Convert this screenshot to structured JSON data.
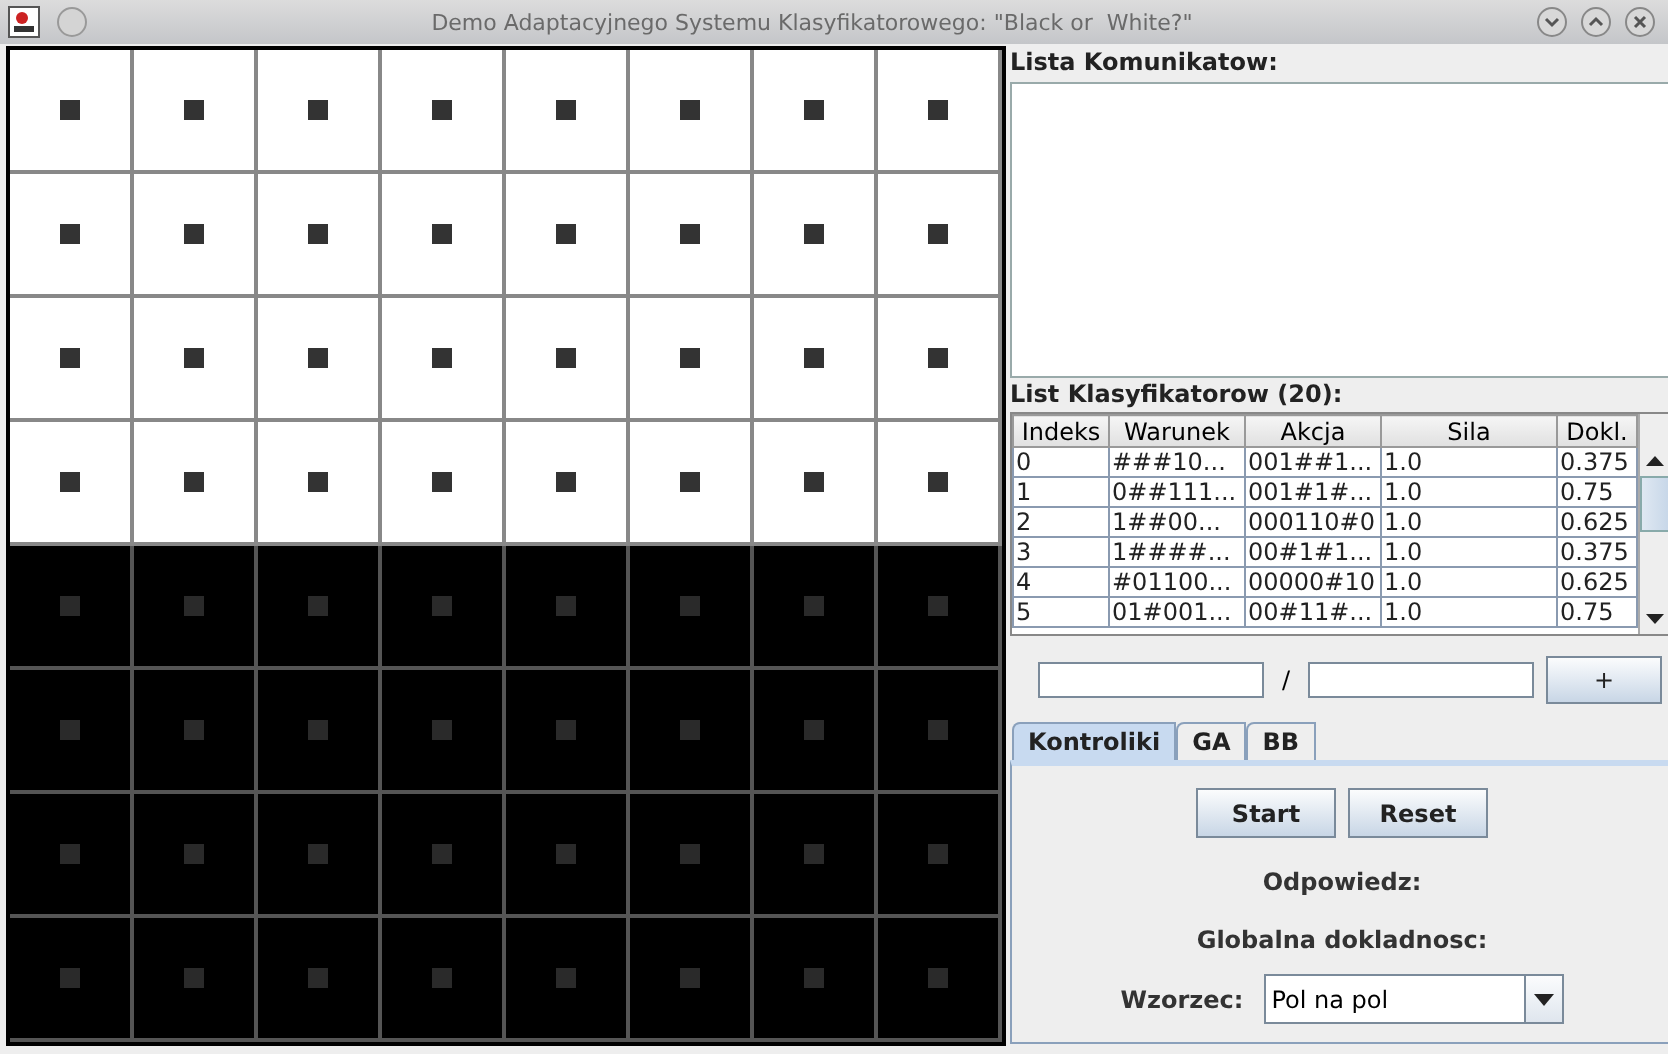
{
  "window": {
    "title": "Demo Adaptacyjnego Systemu Klasyfikatorowego: \"Black or  White?\""
  },
  "board": {
    "rows": [
      {
        "cells": [
          {
            "dark": false
          },
          {
            "dark": false
          },
          {
            "dark": false
          },
          {
            "dark": false
          },
          {
            "dark": false
          },
          {
            "dark": false
          },
          {
            "dark": false
          },
          {
            "dark": false
          }
        ]
      },
      {
        "cells": [
          {
            "dark": false
          },
          {
            "dark": false
          },
          {
            "dark": false
          },
          {
            "dark": false
          },
          {
            "dark": false
          },
          {
            "dark": false
          },
          {
            "dark": false
          },
          {
            "dark": false
          }
        ]
      },
      {
        "cells": [
          {
            "dark": false
          },
          {
            "dark": false
          },
          {
            "dark": false
          },
          {
            "dark": false
          },
          {
            "dark": false
          },
          {
            "dark": false
          },
          {
            "dark": false
          },
          {
            "dark": false
          }
        ]
      },
      {
        "cells": [
          {
            "dark": false
          },
          {
            "dark": false
          },
          {
            "dark": false
          },
          {
            "dark": false
          },
          {
            "dark": false
          },
          {
            "dark": false
          },
          {
            "dark": false
          },
          {
            "dark": false
          }
        ]
      },
      {
        "cells": [
          {
            "dark": true
          },
          {
            "dark": true
          },
          {
            "dark": true
          },
          {
            "dark": true
          },
          {
            "dark": true
          },
          {
            "dark": true
          },
          {
            "dark": true
          },
          {
            "dark": true
          }
        ]
      },
      {
        "cells": [
          {
            "dark": true
          },
          {
            "dark": true
          },
          {
            "dark": true
          },
          {
            "dark": true
          },
          {
            "dark": true
          },
          {
            "dark": true
          },
          {
            "dark": true
          },
          {
            "dark": true
          }
        ]
      },
      {
        "cells": [
          {
            "dark": true
          },
          {
            "dark": true
          },
          {
            "dark": true
          },
          {
            "dark": true
          },
          {
            "dark": true
          },
          {
            "dark": true
          },
          {
            "dark": true
          },
          {
            "dark": true
          }
        ]
      },
      {
        "cells": [
          {
            "dark": true
          },
          {
            "dark": true
          },
          {
            "dark": true
          },
          {
            "dark": true
          },
          {
            "dark": true
          },
          {
            "dark": true
          },
          {
            "dark": true
          },
          {
            "dark": true
          }
        ]
      }
    ]
  },
  "messages": {
    "label": "Lista Komunikatow:"
  },
  "classifiers": {
    "label": "List Klasyfikatorow (20):",
    "columns": [
      "Indeks",
      "Warunek",
      "Akcja",
      "Sila",
      "Dokl."
    ],
    "rows": [
      [
        "0",
        "###10...",
        "001##1...",
        "1.0",
        "0.375"
      ],
      [
        "1",
        "0##111...",
        "001#1#...",
        "1.0",
        "0.75"
      ],
      [
        "2",
        "1##00...",
        "000110#0",
        "1.0",
        "0.625"
      ],
      [
        "3",
        "1####...",
        "00#1#1...",
        "1.0",
        "0.375"
      ],
      [
        "4",
        "#01100...",
        "00000#10",
        "1.0",
        "0.625"
      ],
      [
        "5",
        "01#001...",
        "00#11#...",
        "1.0",
        "0.75"
      ]
    ]
  },
  "input_row": {
    "separator": "/",
    "add_button": "+"
  },
  "tabs": [
    {
      "label": "Kontroliki",
      "selected": true
    },
    {
      "label": "GA",
      "selected": false
    },
    {
      "label": "BB",
      "selected": false
    }
  ],
  "controls": {
    "buttons": [
      "Start",
      "Reset"
    ],
    "answer_label": "Odpowiedz:",
    "accuracy_label": "Globalna dokladnosc:",
    "pattern_label": "Wzorzec:",
    "pattern_value": "Pol na pol"
  }
}
